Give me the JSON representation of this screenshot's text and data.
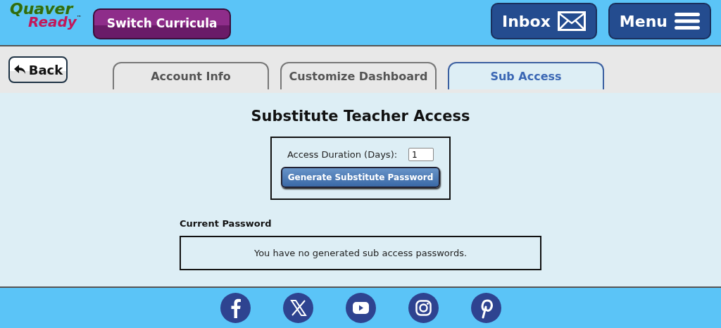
{
  "logo": {
    "line_1": "Quaver",
    "line_2": "Ready",
    "mark": "™"
  },
  "header_buttons": [
    {
      "label": "Switch Curricula",
      "kind": "curricula"
    },
    {
      "label": "Inbox",
      "kind": "inbox"
    },
    {
      "label": "Menu",
      "kind": "menu"
    }
  ],
  "back_button": {
    "label": "Back"
  },
  "tabs": [
    {
      "label": "Account Info",
      "selected": false
    },
    {
      "label": "Customize Dashboard",
      "selected": false
    },
    {
      "label": "Sub Access",
      "selected": true
    }
  ],
  "heading": "Substitute Teacher Access",
  "duration": {
    "label": "Access Duration (Days):",
    "value": "1"
  },
  "generate_button": {
    "label": "Generate Substitute Password"
  },
  "current_password": {
    "label": "Current Password",
    "message": "You have no generated sub access passwords."
  },
  "social_links": [
    {
      "kind": "facebook"
    },
    {
      "kind": "x"
    },
    {
      "kind": "youtube"
    },
    {
      "kind": "instagram"
    },
    {
      "kind": "pinterest"
    }
  ]
}
